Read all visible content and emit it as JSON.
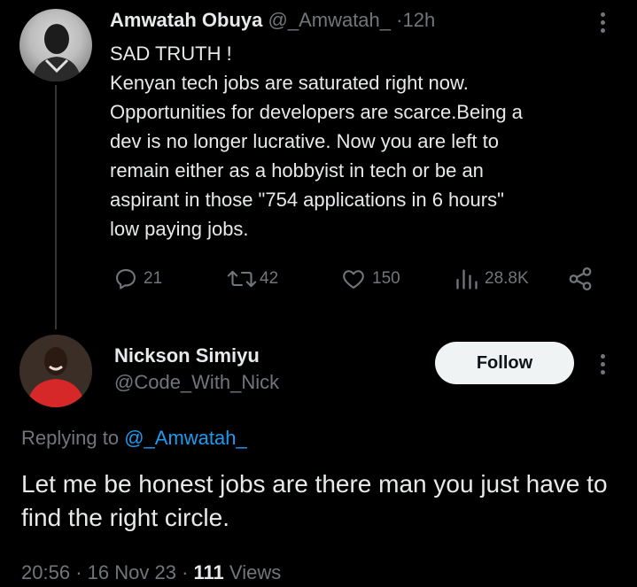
{
  "parent_tweet": {
    "author_name": "Amwatah Obuya",
    "author_handle": "@_Amwatah_",
    "separator": "·",
    "time": "12h",
    "text": "SAD TRUTH !\nKenyan tech jobs are saturated  right now.\nOpportunities for developers are scarce.Being a\ndev is no longer lucrative. Now you are left to\nremain  either as a hobbyist  in tech or be an\naspirant in those  \"754 applications in 6 hours\"\nlow paying  jobs.",
    "actions": {
      "replies": "21",
      "retweets": "42",
      "likes": "150",
      "views": "28.8K"
    },
    "icons": [
      "reply-icon",
      "retweet-icon",
      "like-icon",
      "views-icon",
      "share-icon",
      "more-icon"
    ]
  },
  "reply_tweet": {
    "author_name": "Nickson Simiyu",
    "author_handle": "@Code_With_Nick",
    "follow_label": "Follow",
    "replying_prefix": "Replying to",
    "replying_to": "@_Amwatah_",
    "text": "Let me be honest jobs are there man you just have to find the right circle.",
    "time": "20:56",
    "separator": "·",
    "date": "16 Nov 23",
    "views_count": "111",
    "views_label": "Views"
  },
  "colors": {
    "background": "#000000",
    "text_primary": "#e7e9ea",
    "text_secondary": "#71767b",
    "link": "#1d9bf0",
    "follow_button_bg": "#eff3f4"
  }
}
